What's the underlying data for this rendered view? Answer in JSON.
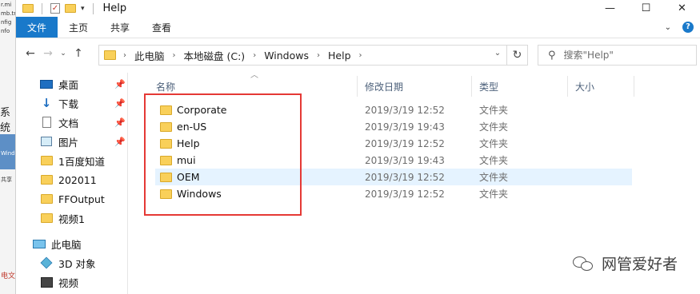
{
  "window": {
    "title": "Help",
    "controls": {
      "minimize": "—",
      "maximize": "☐",
      "close": "✕"
    }
  },
  "ribbon": {
    "tabs": [
      "文件",
      "主页",
      "共享",
      "查看"
    ]
  },
  "address": {
    "crumbs": [
      "此电脑",
      "本地磁盘 (C:)",
      "Windows",
      "Help"
    ]
  },
  "search": {
    "placeholder": "搜索\"Help\""
  },
  "nav_pane": {
    "quick_access": [
      {
        "label": "桌面",
        "icon": "desktop-icon",
        "pinned": true
      },
      {
        "label": "下载",
        "icon": "download-icon",
        "pinned": true
      },
      {
        "label": "文档",
        "icon": "document-icon",
        "pinned": true
      },
      {
        "label": "图片",
        "icon": "picture-icon",
        "pinned": true
      },
      {
        "label": "1百度知道",
        "icon": "folder-icon",
        "pinned": false
      },
      {
        "label": "202011",
        "icon": "folder-icon",
        "pinned": false
      },
      {
        "label": "FFOutput",
        "icon": "folder-icon",
        "pinned": false
      },
      {
        "label": "视频1",
        "icon": "folder-icon",
        "pinned": false
      }
    ],
    "this_pc": {
      "label": "此电脑",
      "icon": "computer-icon"
    },
    "pc_items": [
      {
        "label": "3D 对象",
        "icon": "3d-objects-icon"
      },
      {
        "label": "视频",
        "icon": "video-icon"
      }
    ]
  },
  "columns": {
    "name": "名称",
    "modified": "修改日期",
    "type": "类型",
    "size": "大小"
  },
  "files": [
    {
      "name": "Corporate",
      "modified": "2019/3/19 12:52",
      "type": "文件夹",
      "selected": false
    },
    {
      "name": "en-US",
      "modified": "2019/3/19 19:43",
      "type": "文件夹",
      "selected": false
    },
    {
      "name": "Help",
      "modified": "2019/3/19 12:52",
      "type": "文件夹",
      "selected": false
    },
    {
      "name": "mui",
      "modified": "2019/3/19 19:43",
      "type": "文件夹",
      "selected": false
    },
    {
      "name": "OEM",
      "modified": "2019/3/19 12:52",
      "type": "文件夹",
      "selected": true
    },
    {
      "name": "Windows",
      "modified": "2019/3/19 12:52",
      "type": "文件夹",
      "selected": false
    }
  ],
  "background_window": {
    "fragments": [
      "r.mi",
      "mb.tm",
      "nfig",
      "nfo",
      "系统",
      "Windo",
      "共享"
    ],
    "bottom_text": "电文"
  },
  "watermark": {
    "text": "网管爱好者"
  },
  "colors": {
    "file_tab": "#1979ca",
    "selection": "#e5f3ff",
    "highlight_box": "#e53935"
  }
}
